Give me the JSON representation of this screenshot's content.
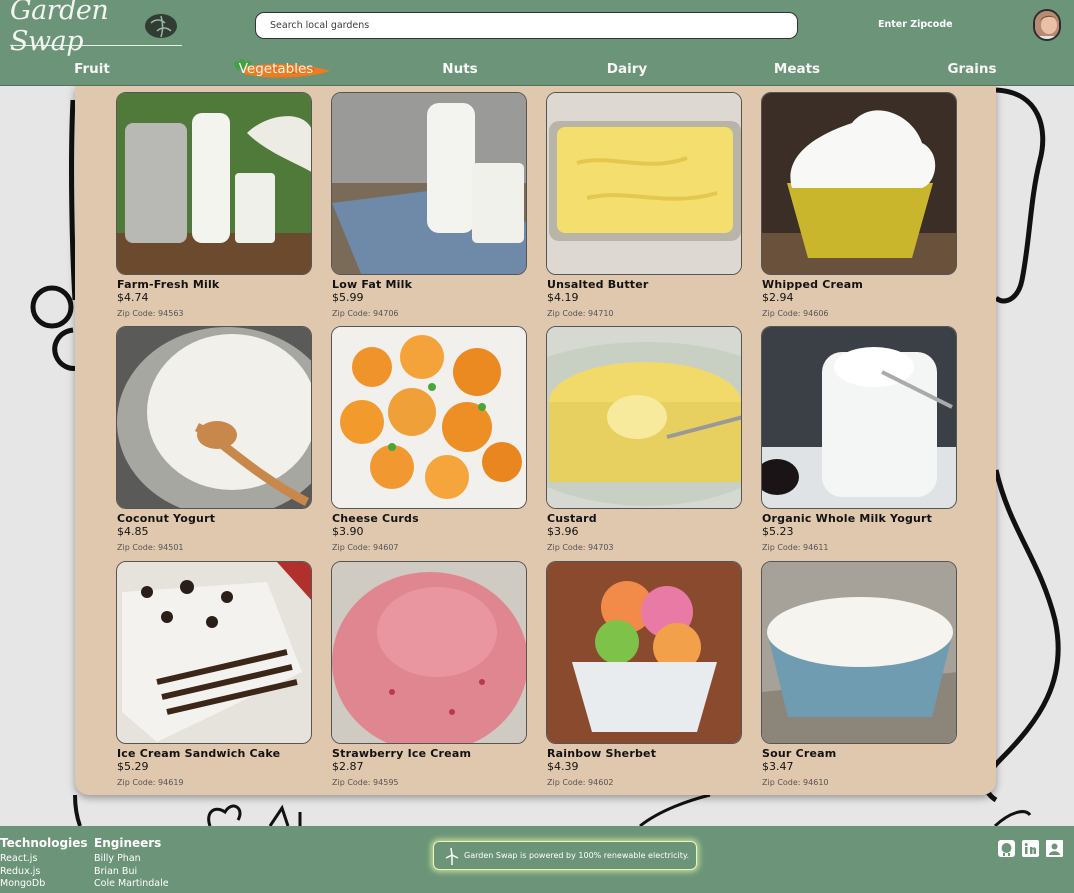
{
  "header": {
    "logo_text": "Garden Swap",
    "search_placeholder": "Search local gardens",
    "zipcode_label": "Enter Zipcode"
  },
  "nav": {
    "items": [
      "Fruit",
      "Vegetables",
      "Nuts",
      "Dairy",
      "Meats",
      "Grains"
    ],
    "highlighted": "Vegetables"
  },
  "products": [
    {
      "name": "Farm-Fresh Milk",
      "price": "$4.74",
      "zip": "Zip Code: 94563"
    },
    {
      "name": "Low Fat Milk",
      "price": "$5.99",
      "zip": "Zip Code: 94706"
    },
    {
      "name": "Unsalted Butter",
      "price": "$4.19",
      "zip": "Zip Code: 94710"
    },
    {
      "name": "Whipped Cream",
      "price": "$2.94",
      "zip": "Zip Code: 94606"
    },
    {
      "name": "Coconut Yogurt",
      "price": "$4.85",
      "zip": "Zip Code: 94501"
    },
    {
      "name": "Cheese Curds",
      "price": "$3.90",
      "zip": "Zip Code: 94607"
    },
    {
      "name": "Custard",
      "price": "$3.96",
      "zip": "Zip Code: 94703"
    },
    {
      "name": "Organic Whole Milk Yogurt",
      "price": "$5.23",
      "zip": "Zip Code: 94611"
    },
    {
      "name": "Ice Cream Sandwich Cake",
      "price": "$5.29",
      "zip": "Zip Code: 94619"
    },
    {
      "name": "Strawberry Ice Cream",
      "price": "$2.87",
      "zip": "Zip Code: 94595"
    },
    {
      "name": "Rainbow Sherbet",
      "price": "$4.39",
      "zip": "Zip Code: 94602"
    },
    {
      "name": "Sour Cream",
      "price": "$3.47",
      "zip": "Zip Code: 94610"
    }
  ],
  "footer": {
    "technologies": {
      "title": "Technologies",
      "items": [
        "React.js",
        "Redux.js",
        "MongoDb"
      ]
    },
    "engineers": {
      "title": "Engineers",
      "items": [
        "Billy Phan",
        "Brian Bui",
        "Cole Martindale"
      ]
    },
    "eco_message": "Garden Swap is powered by 100% renewable electricity.",
    "social_icons": [
      "github-icon",
      "linkedin-icon",
      "contact-icon"
    ]
  },
  "colors": {
    "header_bg": "#6c9479",
    "panel_bg": "#e0c8ae",
    "page_bg": "#e6e6e6",
    "carrot": "#f07a1e"
  }
}
